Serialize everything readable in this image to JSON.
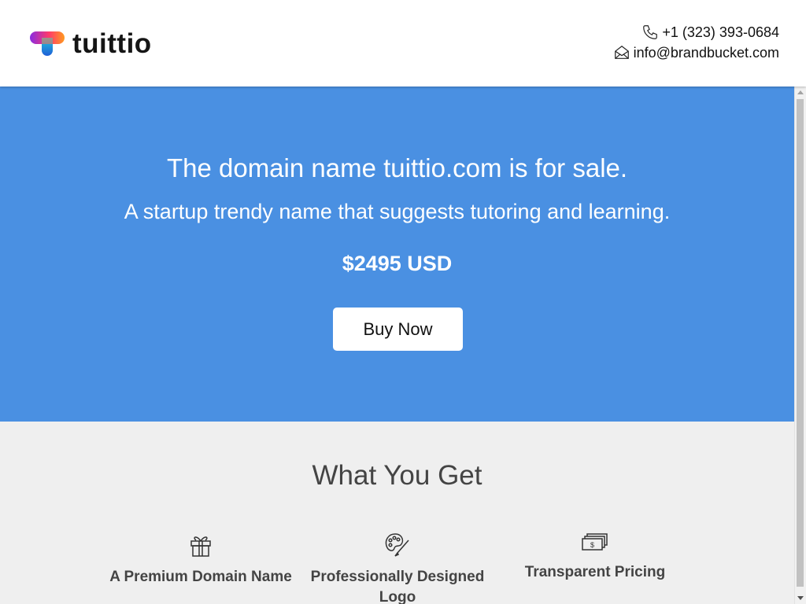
{
  "header": {
    "logo_text": "tuittio",
    "phone": "+1 (323) 393-0684",
    "email": "info@brandbucket.com",
    "icons": {
      "phone": "phone-icon",
      "email": "envelope-icon"
    }
  },
  "hero": {
    "title": "The domain name tuittio.com is for sale.",
    "subtitle": "A startup trendy name that suggests tutoring and learning.",
    "price": "$2495 USD",
    "button_label": "Buy Now",
    "background_color": "#4a90e2"
  },
  "features": {
    "title": "What You Get",
    "items": [
      {
        "icon": "gift-icon",
        "label": "A Premium Domain Name"
      },
      {
        "icon": "palette-icon",
        "label": "Professionally Designed Logo"
      },
      {
        "icon": "cash-icon",
        "label": "Transparent Pricing"
      }
    ]
  },
  "colors": {
    "hero_blue": "#4a90e2",
    "logo_gradient": [
      "#8a2be2",
      "#ff3b6b",
      "#ff9a1f",
      "#1e88e5"
    ]
  }
}
